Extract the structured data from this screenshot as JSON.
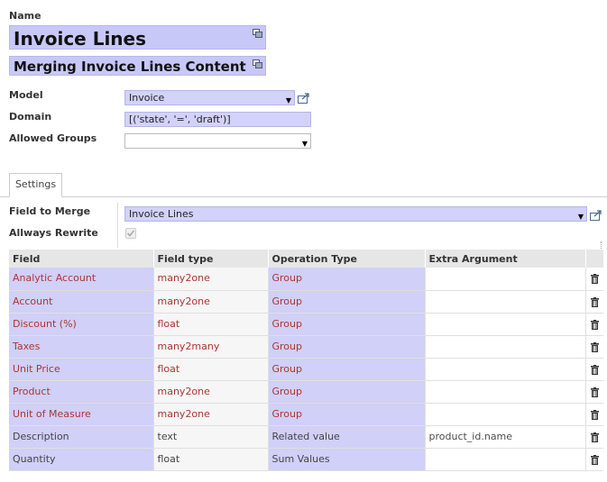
{
  "header": {
    "name_label": "Name",
    "name_value": "Invoice Lines",
    "description_value": "Merging Invoice Lines Content"
  },
  "form": {
    "model_label": "Model",
    "model_value": "Invoice",
    "domain_label": "Domain",
    "domain_value": "[('state', '=', 'draft')]",
    "groups_label": "Allowed Groups",
    "groups_value": ""
  },
  "tabs": [
    {
      "label": "Settings",
      "active": true
    }
  ],
  "settings": {
    "field_to_merge_label": "Field to Merge",
    "field_to_merge_value": "Invoice Lines",
    "always_rewrite_label": "Allways Rewrite",
    "always_rewrite_checked": true
  },
  "table": {
    "columns": [
      "Field",
      "Field type",
      "Operation Type",
      "Extra Argument"
    ],
    "rows": [
      {
        "field": "Analytic Account",
        "type": "many2one",
        "operation": "Group",
        "extra": "",
        "highlight": true
      },
      {
        "field": "Account",
        "type": "many2one",
        "operation": "Group",
        "extra": "",
        "highlight": true
      },
      {
        "field": "Discount (%)",
        "type": "float",
        "operation": "Group",
        "extra": "",
        "highlight": true
      },
      {
        "field": "Taxes",
        "type": "many2many",
        "operation": "Group",
        "extra": "",
        "highlight": true
      },
      {
        "field": "Unit Price",
        "type": "float",
        "operation": "Group",
        "extra": "",
        "highlight": true
      },
      {
        "field": "Product",
        "type": "many2one",
        "operation": "Group",
        "extra": "",
        "highlight": true
      },
      {
        "field": "Unit of Measure",
        "type": "many2one",
        "operation": "Group",
        "extra": "",
        "highlight": true
      },
      {
        "field": "Description",
        "type": "text",
        "operation": "Related value",
        "extra": "product_id.name",
        "highlight": false
      },
      {
        "field": "Quantity",
        "type": "float",
        "operation": "Sum Values",
        "extra": "",
        "highlight": false
      }
    ]
  },
  "icons": {
    "translate": "translate-icon",
    "external": "external-link-icon",
    "delete": "trash-icon",
    "dropdown": "chevron-down-icon"
  },
  "colors": {
    "required_bg": "#d0d0f8",
    "highlight_text": "#b03434",
    "header_bg": "#e6e6e6"
  }
}
